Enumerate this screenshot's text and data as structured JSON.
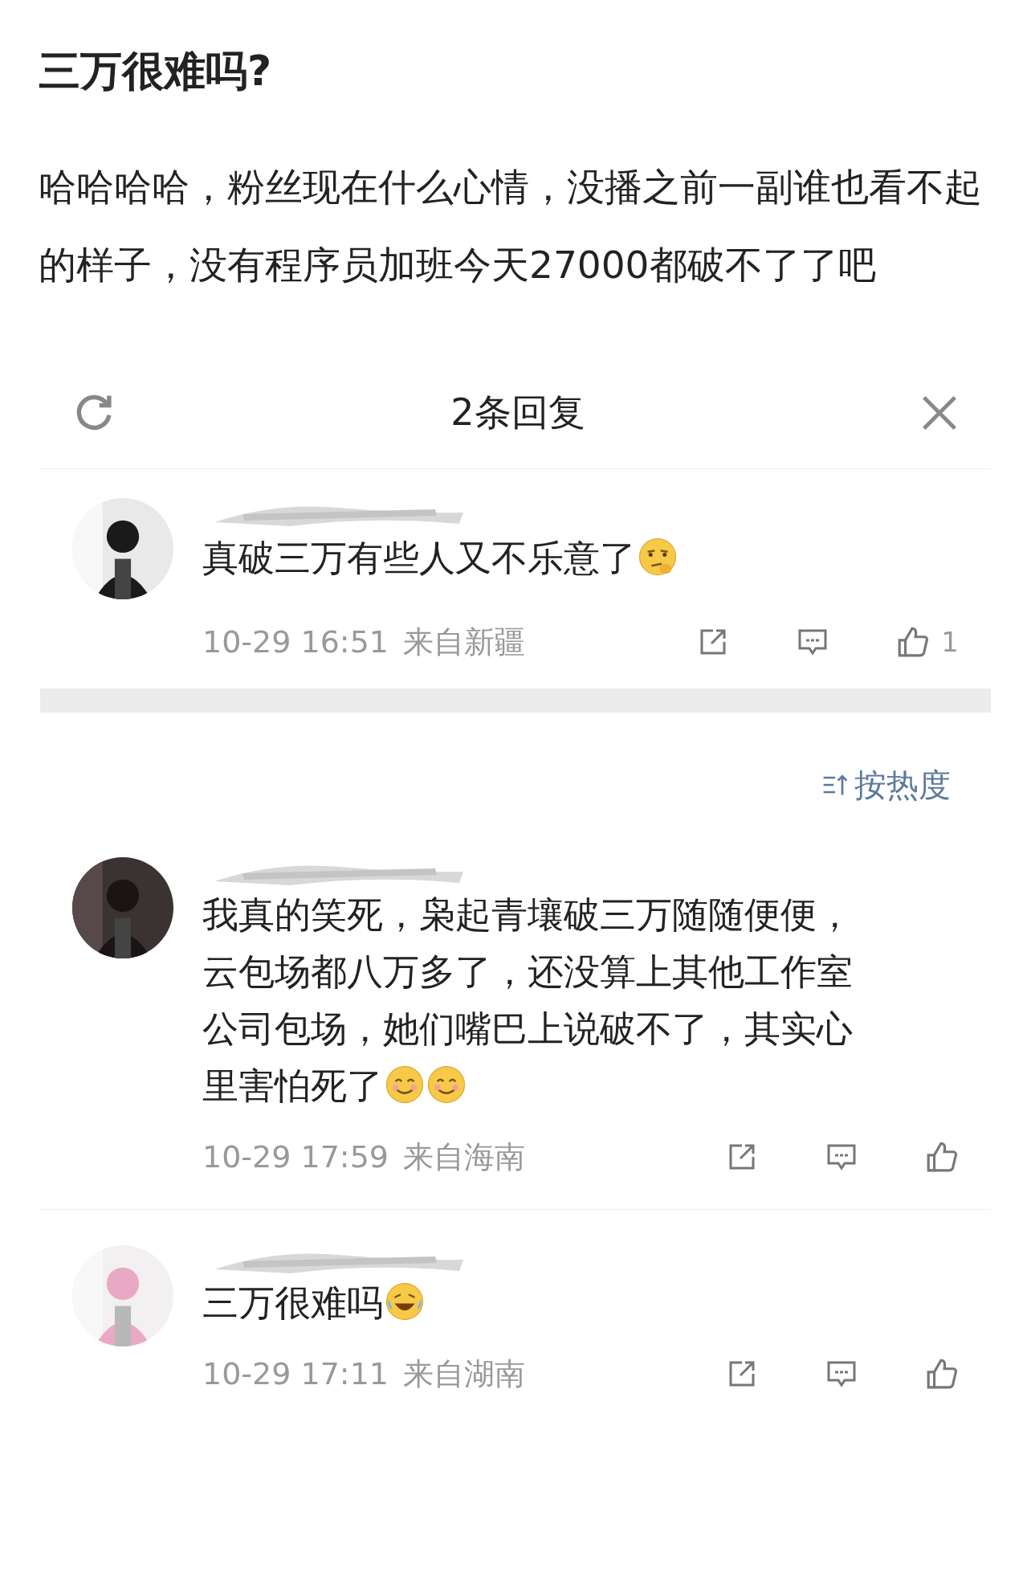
{
  "post": {
    "title": "三万很难吗?",
    "body": "哈哈哈哈，粉丝现在什么心情，没播之前一副谁也看不起的样子，没有程序员加班今天27000都破不了了吧"
  },
  "reply_panel": {
    "title": "2条回复",
    "root_comment": {
      "text": "真破三万有些人又不乐意了",
      "emojis": [
        {
          "kind": "thinking"
        }
      ],
      "time": "10-29 16:51",
      "location": "来自新疆",
      "likes": "1"
    }
  },
  "sort": {
    "label": "按热度"
  },
  "comments": [
    {
      "lines": [
        "我真的笑死，枭起青壤破三万随随便便，",
        "云包场都八万多了，还没算上其他工作室",
        "公司包场，她们嘴巴上说破不了，其实心",
        "里害怕死了"
      ],
      "emojis": [
        {
          "kind": "smile"
        },
        {
          "kind": "smile"
        }
      ],
      "time": "10-29 17:59",
      "location": "来自海南"
    },
    {
      "lines": [
        "三万很难吗"
      ],
      "emojis": [
        {
          "kind": "laugh_cry"
        }
      ],
      "time": "10-29 17:11",
      "location": "来自湖南"
    }
  ]
}
